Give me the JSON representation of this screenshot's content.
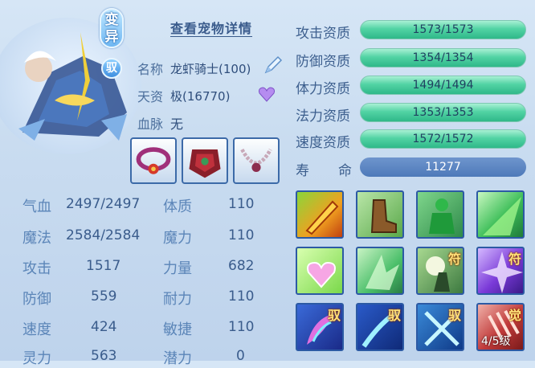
{
  "header": {
    "detail_link": "查看宠物详情",
    "badge_mutant": "变异",
    "badge_rider": "驭"
  },
  "info": {
    "name_label": "名称",
    "name_value": "龙虾骑士(100)",
    "talent_label": "天资",
    "talent_value": "极(16770)",
    "bloodline_label": "血脉",
    "bloodline_value": "无"
  },
  "equipment": [
    {
      "icon": "collar-icon"
    },
    {
      "icon": "armor-icon"
    },
    {
      "icon": "necklace-icon"
    }
  ],
  "stats_left": [
    {
      "label": "气血",
      "value": "2497/2497"
    },
    {
      "label": "魔法",
      "value": "2584/2584"
    },
    {
      "label": "攻击",
      "value": "1517"
    },
    {
      "label": "防御",
      "value": "559"
    },
    {
      "label": "速度",
      "value": "424"
    },
    {
      "label": "灵力",
      "value": "563"
    }
  ],
  "stats_right": [
    {
      "label": "体质",
      "value": "110"
    },
    {
      "label": "魔力",
      "value": "110"
    },
    {
      "label": "力量",
      "value": "682"
    },
    {
      "label": "耐力",
      "value": "110"
    },
    {
      "label": "敏捷",
      "value": "110"
    },
    {
      "label": "潜力",
      "value": "0"
    }
  ],
  "aptitudes": [
    {
      "label": "攻击资质",
      "value": "1573/1573"
    },
    {
      "label": "防御资质",
      "value": "1354/1354"
    },
    {
      "label": "体力资质",
      "value": "1494/1494"
    },
    {
      "label": "法力资质",
      "value": "1353/1353"
    },
    {
      "label": "速度资质",
      "value": "1572/1572"
    }
  ],
  "lifespan": {
    "label_1": "寿",
    "label_2": "命",
    "value": "11277"
  },
  "skills": [
    {
      "icon": "blade-strike-icon",
      "tag": "",
      "level": ""
    },
    {
      "icon": "boot-icon",
      "tag": "",
      "level": ""
    },
    {
      "icon": "green-giant-icon",
      "tag": "",
      "level": ""
    },
    {
      "icon": "green-burst-icon",
      "tag": "",
      "level": ""
    },
    {
      "icon": "heart-shield-icon",
      "tag": "",
      "level": ""
    },
    {
      "icon": "green-shards-icon",
      "tag": "",
      "level": ""
    },
    {
      "icon": "moon-warrior-icon",
      "tag": "符",
      "level": ""
    },
    {
      "icon": "purple-burst-icon",
      "tag": "符",
      "level": ""
    },
    {
      "icon": "pink-wing-icon",
      "tag": "驭",
      "level": ""
    },
    {
      "icon": "blue-slash-icon",
      "tag": "驭",
      "level": ""
    },
    {
      "icon": "blue-cross-icon",
      "tag": "驭",
      "level": ""
    },
    {
      "icon": "red-claw-icon",
      "tag": "觉",
      "level": "4/5级"
    }
  ],
  "colors": {
    "aptitude_bar": "#52d3a4",
    "life_bar": "#4d79b9",
    "skill_border": "#2c5aa4"
  }
}
